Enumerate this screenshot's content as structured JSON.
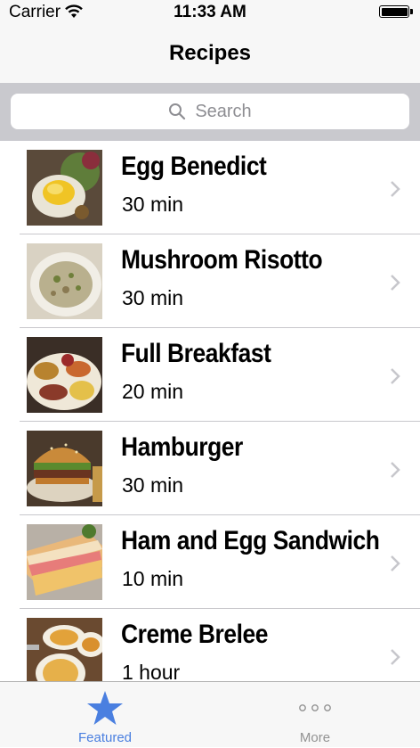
{
  "status_bar": {
    "carrier": "Carrier",
    "time": "11:33 AM"
  },
  "nav": {
    "title": "Recipes"
  },
  "search": {
    "placeholder": "Search"
  },
  "recipes": [
    {
      "title": "Egg Benedict",
      "duration": "30 min"
    },
    {
      "title": "Mushroom Risotto",
      "duration": "30 min"
    },
    {
      "title": "Full Breakfast",
      "duration": "20 min"
    },
    {
      "title": "Hamburger",
      "duration": "30 min"
    },
    {
      "title": "Ham and Egg Sandwich",
      "duration": "10 min"
    },
    {
      "title": "Creme Brelee",
      "duration": "1 hour"
    }
  ],
  "tab_bar": {
    "tabs": [
      {
        "label": "Featured",
        "icon": "star-icon",
        "selected": true
      },
      {
        "label": "More",
        "icon": "more-icon",
        "selected": false
      }
    ]
  },
  "colors": {
    "accent": "#4a7fe0",
    "separator": "#c8c7cc",
    "search_bg": "#c9c9ce"
  }
}
